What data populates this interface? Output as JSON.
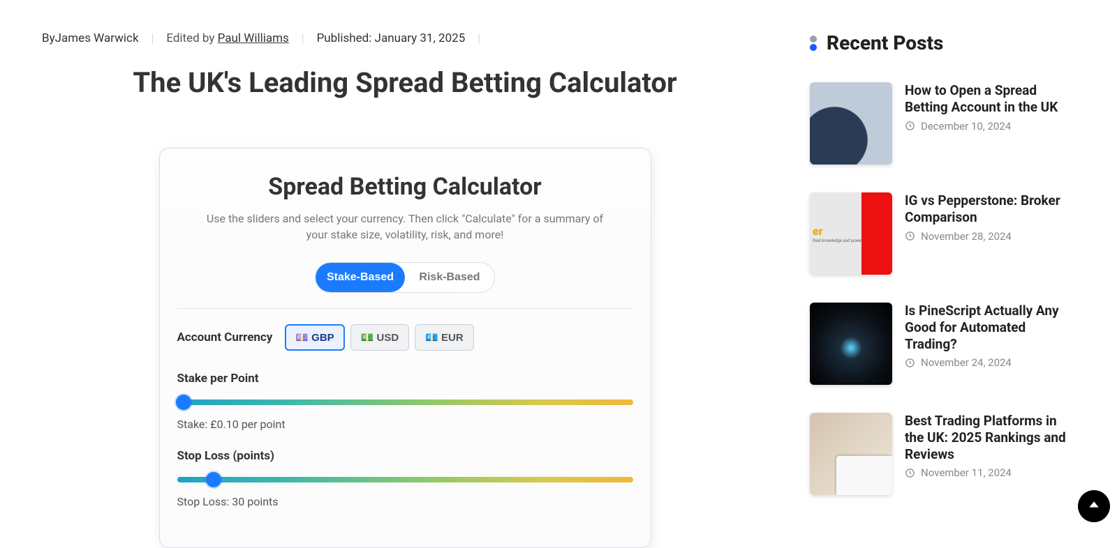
{
  "meta": {
    "by_prefix": "By",
    "author": "James Warwick",
    "div": "|",
    "edited_prefix": "Edited by ",
    "editor": "Paul Williams",
    "published": "Published: January 31, 2025"
  },
  "page_title": "The UK's Leading Spread Betting Calculator",
  "calc": {
    "title": "Spread Betting Calculator",
    "desc": "Use the sliders and select your currency. Then click \"Calculate\" for a summary of your stake size, volatility, risk, and more!",
    "mode": {
      "stake": "Stake-Based",
      "risk": "Risk-Based"
    },
    "currency_label": "Account Currency",
    "currencies": {
      "gbp": "💷 GBP",
      "usd": "💵 USD",
      "eur": "💶 EUR"
    },
    "stake": {
      "label": "Stake per Point",
      "value_text": "Stake: £0.10 per point",
      "thumb_pct": 1.5
    },
    "stoploss": {
      "label": "Stop Loss (points)",
      "value_text": "Stop Loss: 30 points",
      "thumb_pct": 8
    }
  },
  "sidebar": {
    "heading": "Recent Posts",
    "posts": [
      {
        "title": "How to Open a Spread Betting Account in the UK",
        "date": "December 10, 2024"
      },
      {
        "title": "IG vs Pepperstone: Broker Comparison",
        "date": "November 28, 2024"
      },
      {
        "title": "Is PineScript Actually Any Good for Automated Trading?",
        "date": "November 24, 2024"
      },
      {
        "title": "Best Trading Platforms in the UK: 2025 Rankings and Reviews",
        "date": "November 11, 2024"
      }
    ]
  }
}
